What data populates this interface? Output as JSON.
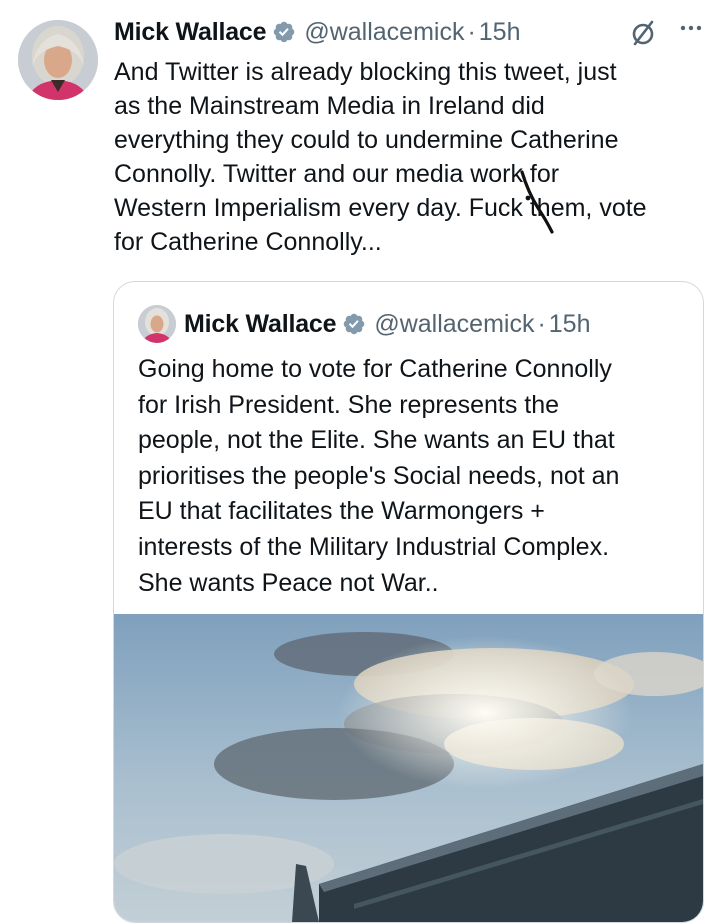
{
  "tweet": {
    "author_name": "Mick Wallace",
    "author_handle": "@wallacemick",
    "separator": "·",
    "time": "15h",
    "text": "And Twitter is already blocking this tweet, just\nas the Mainstream Media in Ireland did\neverything they could to undermine Catherine\nConnolly. Twitter and our media work for\nWestern Imperialism every day. Fuck them, vote\nfor Catherine Connolly...",
    "icons": [
      "avatar",
      "verified-badge-icon",
      "grok-icon",
      "more-options-icon"
    ]
  },
  "quoted_tweet": {
    "author_name": "Mick Wallace",
    "author_handle": "@wallacemick",
    "separator": "·",
    "time": "15h",
    "text": "Going home to vote for Catherine Connolly\nfor Irish President. She represents the\npeople, not the Elite. She wants an EU that\nprioritises the people's Social needs, not an\nEU that facilitates the Warmongers +\ninterests of the Military Industrial Complex.\nShe wants Peace not War..",
    "media": "photo-sky-and-building"
  },
  "colors": {
    "text": "#0f1419",
    "secondary": "#536471",
    "verified": "#829aab",
    "border": "#cfd9de"
  }
}
